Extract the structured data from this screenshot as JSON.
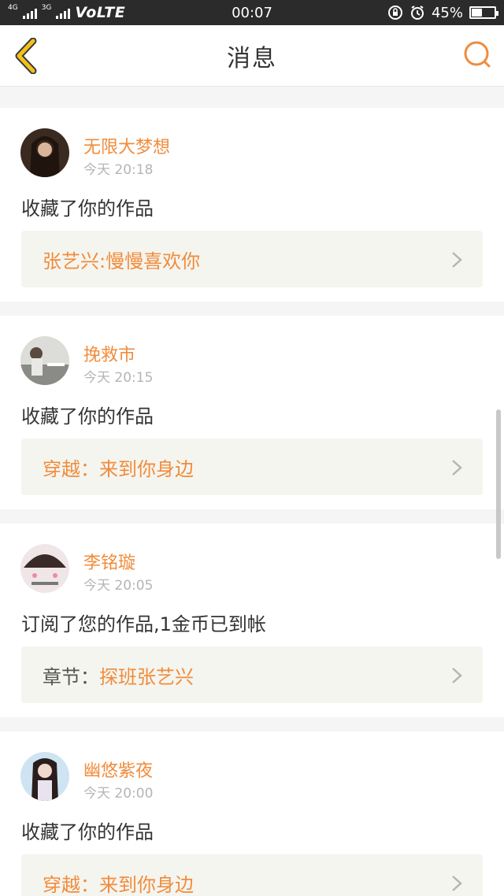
{
  "status_bar": {
    "net_1": "4G",
    "net_2": "3G",
    "carrier_mode": "VoLTE",
    "time": "00:07",
    "battery_percent": "45%",
    "battery_level": 0.45
  },
  "nav": {
    "title": "消息",
    "back_icon": "chevron-left-icon",
    "search_icon": "search-icon"
  },
  "colors": {
    "accent": "#f08c3c",
    "back_yellow": "#f2c21a",
    "link_bg": "#f5f5ef"
  },
  "messages": [
    {
      "username": "无限大梦想",
      "time": "今天 20:18",
      "action": "收藏了你的作品",
      "work_prefix": "",
      "work_title": "张艺兴:慢慢喜欢你"
    },
    {
      "username": "挽救市",
      "time": "今天 20:15",
      "action": "收藏了你的作品",
      "work_prefix": "",
      "work_title": "穿越：来到你身边"
    },
    {
      "username": "李铭璇",
      "time": "今天 20:05",
      "action": "订阅了您的作品,1金币已到帐",
      "work_prefix": "章节：",
      "work_title": "探班张艺兴"
    },
    {
      "username": "幽悠紫夜",
      "time": "今天 20:00",
      "action": "收藏了你的作品",
      "work_prefix": "",
      "work_title": "穿越：来到你身边"
    }
  ]
}
